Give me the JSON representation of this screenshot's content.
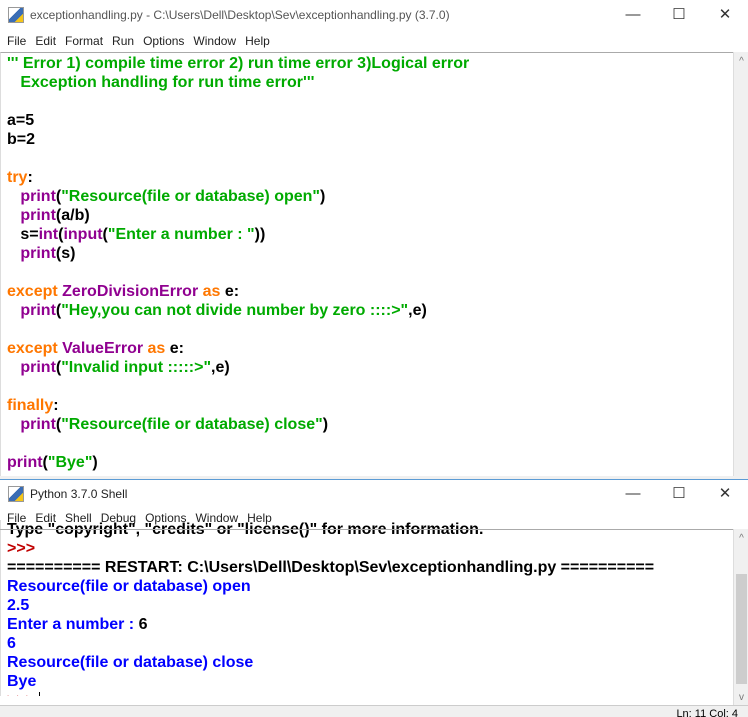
{
  "editor": {
    "title": "exceptionhandling.py - C:\\Users\\Dell\\Desktop\\Sev\\exceptionhandling.py (3.7.0)",
    "menu": [
      "File",
      "Edit",
      "Format",
      "Run",
      "Options",
      "Window",
      "Help"
    ],
    "controls": {
      "minimize": "—",
      "maximize": "☐",
      "close": "✕"
    },
    "lines": [
      [
        [
          "''' Error 1) compile time error 2) run time error 3)Logical error",
          "st"
        ]
      ],
      [
        [
          "   Exception handling for run time error'''",
          "st"
        ]
      ],
      [],
      [
        [
          "a=5",
          "df"
        ]
      ],
      [
        [
          "b=2",
          "df"
        ]
      ],
      [],
      [
        [
          "try",
          "kw"
        ],
        [
          ":",
          "df"
        ]
      ],
      [
        [
          "   ",
          "df"
        ],
        [
          "print",
          "bi"
        ],
        [
          "(",
          "df"
        ],
        [
          "\"Resource(file or database) open\"",
          "st"
        ],
        [
          ")",
          "df"
        ]
      ],
      [
        [
          "   ",
          "df"
        ],
        [
          "print",
          "bi"
        ],
        [
          "(a/b)",
          "df"
        ]
      ],
      [
        [
          "   s=",
          "df"
        ],
        [
          "int",
          "bi"
        ],
        [
          "(",
          "df"
        ],
        [
          "input",
          "bi"
        ],
        [
          "(",
          "df"
        ],
        [
          "\"Enter a number : \"",
          "st"
        ],
        [
          "))",
          "df"
        ]
      ],
      [
        [
          "   ",
          "df"
        ],
        [
          "print",
          "bi"
        ],
        [
          "(s)",
          "df"
        ]
      ],
      [],
      [
        [
          "except ",
          "kw"
        ],
        [
          "ZeroDivisionError ",
          "bi"
        ],
        [
          "as ",
          "kw"
        ],
        [
          "e:",
          "df"
        ]
      ],
      [
        [
          "   ",
          "df"
        ],
        [
          "print",
          "bi"
        ],
        [
          "(",
          "df"
        ],
        [
          "\"Hey,you can not divide number by zero ::::>\"",
          "st"
        ],
        [
          ",e)",
          "df"
        ]
      ],
      [],
      [
        [
          "except ",
          "kw"
        ],
        [
          "ValueError ",
          "bi"
        ],
        [
          "as ",
          "kw"
        ],
        [
          "e:",
          "df"
        ]
      ],
      [
        [
          "   ",
          "df"
        ],
        [
          "print",
          "bi"
        ],
        [
          "(",
          "df"
        ],
        [
          "\"Invalid input :::::>\"",
          "st"
        ],
        [
          ",e)",
          "df"
        ]
      ],
      [],
      [
        [
          "finally",
          "kw"
        ],
        [
          ":",
          "df"
        ]
      ],
      [
        [
          "   ",
          "df"
        ],
        [
          "print",
          "bi"
        ],
        [
          "(",
          "df"
        ],
        [
          "\"Resource(file or database) close\"",
          "st"
        ],
        [
          ")",
          "df"
        ]
      ],
      [],
      [
        [
          "print",
          "bi"
        ],
        [
          "(",
          "df"
        ],
        [
          "\"Bye\"",
          "st"
        ],
        [
          ")",
          "df"
        ]
      ]
    ]
  },
  "shell": {
    "title": "Python 3.7.0 Shell",
    "menu": [
      "File",
      "Edit",
      "Shell",
      "Debug",
      "Options",
      "Window",
      "Help"
    ],
    "controls": {
      "minimize": "—",
      "maximize": "☐",
      "close": "✕"
    },
    "lines": [
      [
        [
          "Type \"copyright\", \"credits\" or \"license()\" for more information.",
          "df"
        ]
      ],
      [
        [
          ">>> ",
          "pr"
        ]
      ],
      [
        [
          "========== RESTART: C:\\Users\\Dell\\Desktop\\Sev\\exceptionhandling.py ==========",
          "df"
        ]
      ],
      [
        [
          "Resource(file or database) open",
          "out"
        ]
      ],
      [
        [
          "2.5",
          "out"
        ]
      ],
      [
        [
          "Enter a number : ",
          "out"
        ],
        [
          "6",
          "df"
        ]
      ],
      [
        [
          "6",
          "out"
        ]
      ],
      [
        [
          "Resource(file or database) close",
          "out"
        ]
      ],
      [
        [
          "Bye",
          "out"
        ]
      ],
      [
        [
          ">>> ",
          "pr"
        ]
      ]
    ],
    "status": "Ln: 11   Col: 4"
  }
}
